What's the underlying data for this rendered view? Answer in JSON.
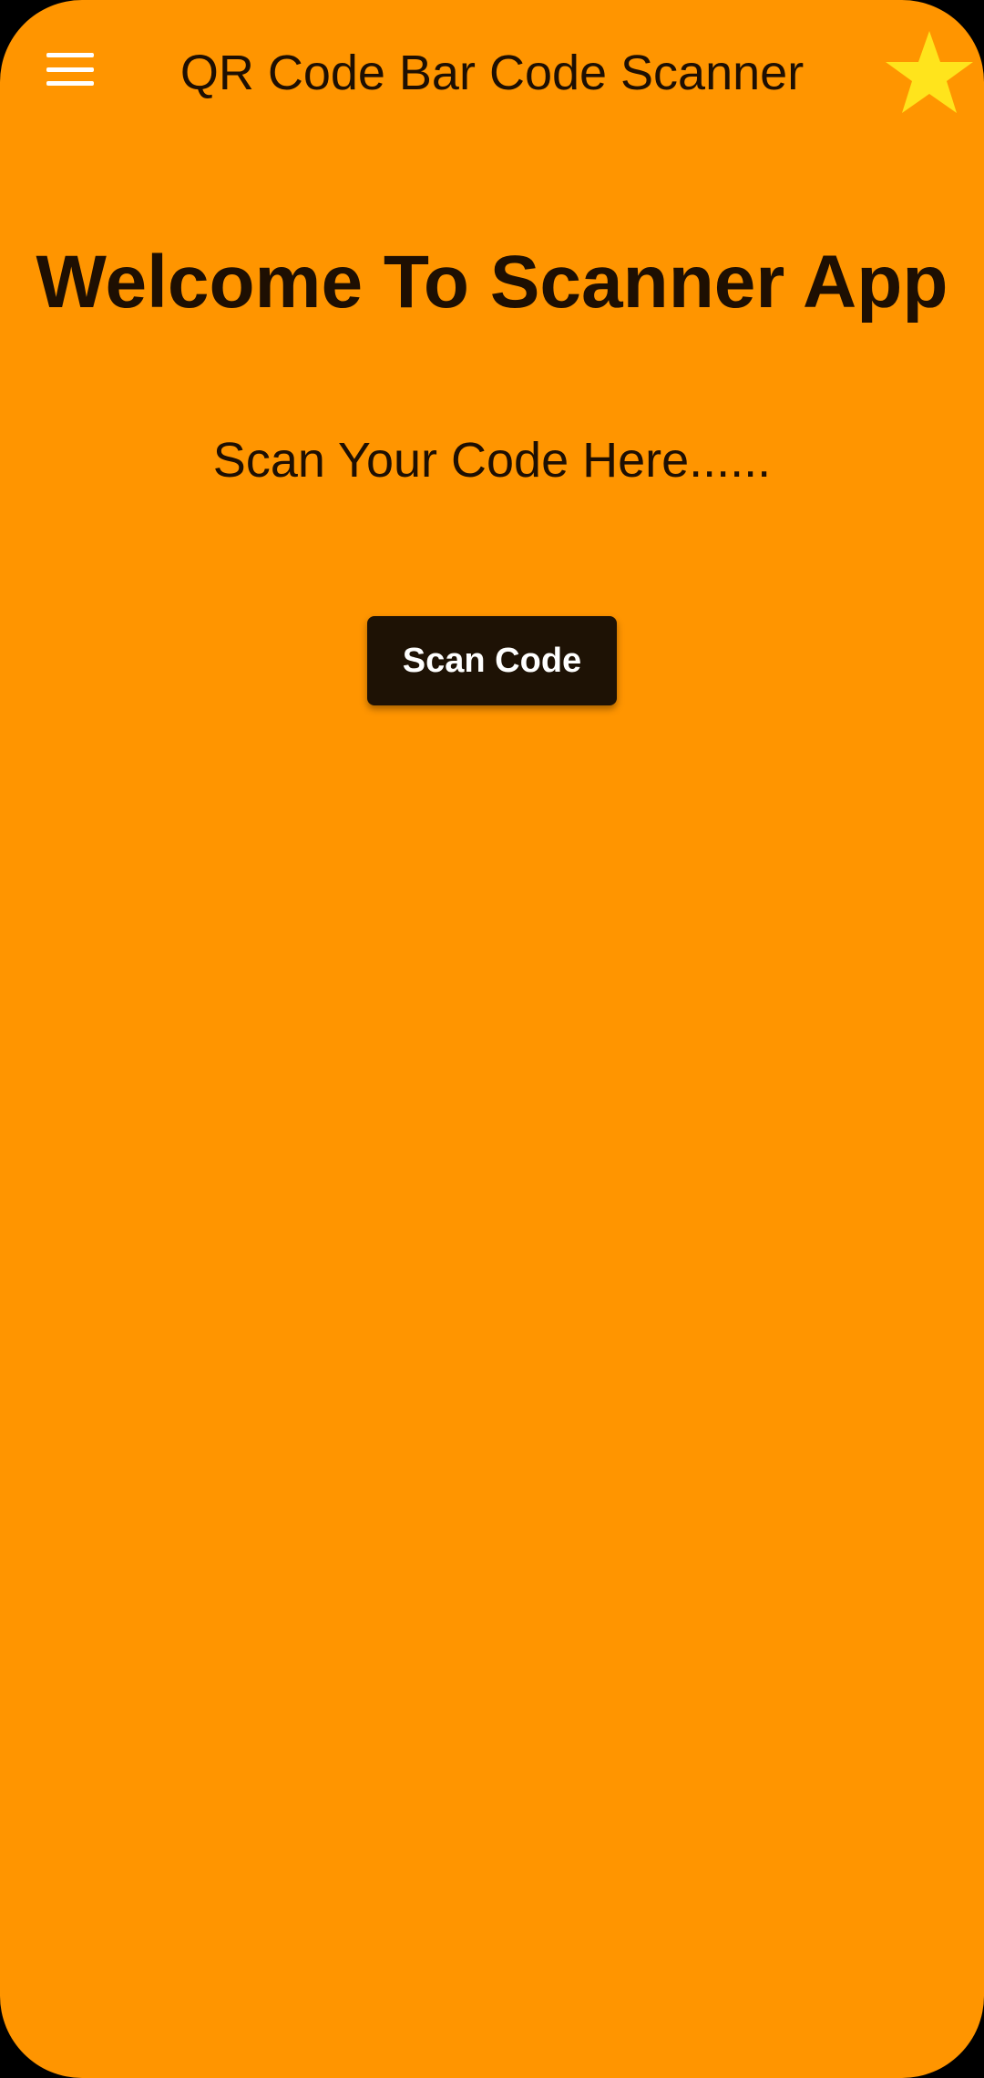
{
  "app_bar": {
    "title": "QR Code Bar Code Scanner",
    "menu_icon": "hamburger-menu-icon",
    "favorite_icon": "star-icon"
  },
  "main": {
    "welcome_text": "Welcome To Scanner App",
    "subtitle": "Scan Your Code Here......",
    "scan_button_label": "Scan Code"
  },
  "colors": {
    "background": "#FF9500",
    "text": "#1E0F02",
    "button_background": "#1E1205",
    "button_text": "#FFFFFF",
    "star": "#FFE41C",
    "menu_icon": "#FFFFFF"
  }
}
